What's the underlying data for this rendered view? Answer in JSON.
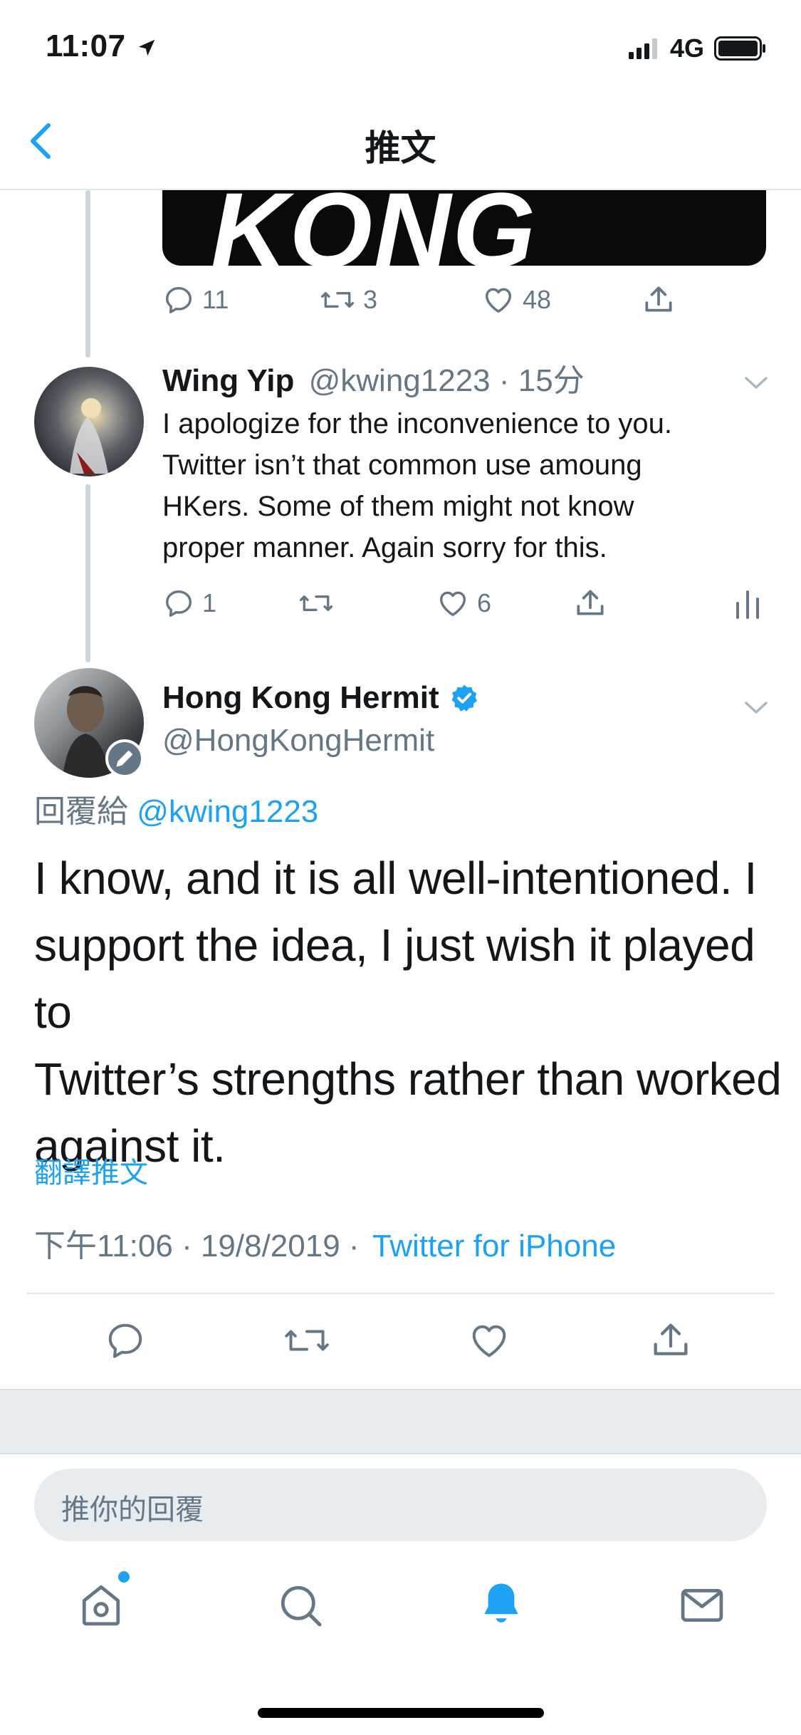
{
  "status_bar": {
    "time": "11:07",
    "network": "4G"
  },
  "nav": {
    "title": "推文"
  },
  "prev_tweet": {
    "image_text": "KONG",
    "replies": "11",
    "retweets": "3",
    "likes": "48"
  },
  "reply_tweet": {
    "name": "Wing Yip",
    "handle_time": "@kwing1223 · 15分",
    "text_lines": [
      "I apologize for the inconvenience to you.",
      "Twitter isn’t that common use amoung",
      "HKers. Some of them might not know",
      "proper manner. Again sorry for this."
    ],
    "replies": "1",
    "likes": "6"
  },
  "main_tweet": {
    "name": "Hong Kong Hermit",
    "handle": "@HongKongHermit",
    "reply_prefix": "回覆給",
    "reply_to": "@kwing1223",
    "text_lines": [
      "I know, and it is all well-intentioned. I",
      "support the idea, I just wish it played to",
      "Twitter’s strengths rather than worked",
      "against it."
    ],
    "translate": "翻譯推文",
    "timestamp": "下午11:06 · 19/8/2019 ·",
    "source": "Twitter for iPhone"
  },
  "reply_input": {
    "placeholder": "推你的回覆"
  },
  "colors": {
    "accent": "#1da1f2",
    "text": "#14171a",
    "secondary": "#657786"
  }
}
